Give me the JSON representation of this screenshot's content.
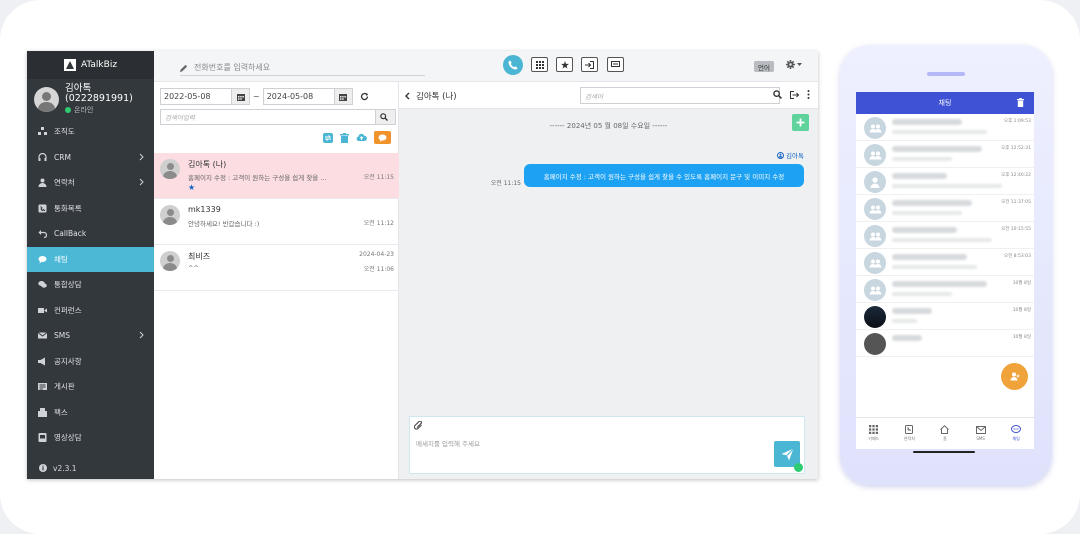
{
  "app": {
    "name": "ATalkBiz",
    "version": "v2.3.1"
  },
  "profile": {
    "name": "김아톡\n(0222891991)",
    "status": "온라인"
  },
  "sidebar": {
    "items": [
      {
        "label": "조직도",
        "icon": "org-icon"
      },
      {
        "label": "CRM",
        "icon": "headset-icon",
        "has_submenu": true
      },
      {
        "label": "연락처",
        "icon": "contact-icon",
        "has_submenu": true
      },
      {
        "label": "통화목록",
        "icon": "call-log-icon"
      },
      {
        "label": "CallBack",
        "icon": "callback-icon"
      },
      {
        "label": "채팅",
        "icon": "chat-icon",
        "active": true
      },
      {
        "label": "통합상담",
        "icon": "consult-icon"
      },
      {
        "label": "컨퍼런스",
        "icon": "video-icon"
      },
      {
        "label": "SMS",
        "icon": "sms-icon",
        "has_submenu": true
      },
      {
        "label": "공지사항",
        "icon": "megaphone-icon"
      },
      {
        "label": "게시판",
        "icon": "board-icon"
      },
      {
        "label": "팩스",
        "icon": "fax-icon"
      },
      {
        "label": "영상상담",
        "icon": "video-consult-icon"
      }
    ]
  },
  "topbar": {
    "phone_placeholder": "전화번호를 입력하세요",
    "language_label": "언어"
  },
  "list": {
    "date_from": "2022-05-08",
    "date_to": "2024-05-08",
    "date_sep": "~",
    "search_placeholder": "검색어입력",
    "chats": [
      {
        "name": "김아톡 (나)",
        "preview": "홈페이지 수정 : 고객이 원하는 구성을 쉽게 찾을 ...",
        "time": "오전 11:15",
        "date": "",
        "starred": true,
        "selected": true
      },
      {
        "name": "mk1339",
        "preview": "안녕하세요! 반갑습니다 :)",
        "time": "오전 11:12",
        "date": "",
        "starred": false,
        "selected": false
      },
      {
        "name": "최비즈",
        "preview": "^^",
        "time": "오전 11:06",
        "date": "2024-04-23",
        "starred": false,
        "selected": false
      }
    ]
  },
  "conversation": {
    "title": "김아톡 (나)",
    "search_placeholder": "검색어",
    "date_separator": "------ 2024년 05 월 08일 수요일 ------",
    "messages": [
      {
        "sender": "김아톡",
        "text": "홈페이지 수정 : 고객이 원하는 구성을 쉽게 찾을 수 있도록 홈페이지 문구 및 이미지 수정",
        "time": "오전 11:15"
      }
    ],
    "composer_placeholder": "메세지를 입력해 주세요"
  },
  "mobile": {
    "title": "채팅",
    "rows": [
      {
        "time": "오후 1:09:53",
        "avatar": "group"
      },
      {
        "time": "오후 12:52:31",
        "avatar": "group"
      },
      {
        "time": "오후 12:40:22",
        "avatar": "person"
      },
      {
        "time": "오전 11:37:05",
        "avatar": "group"
      },
      {
        "time": "오전 10:15:55",
        "avatar": "group"
      },
      {
        "time": "오전 8:53:03",
        "avatar": "group"
      },
      {
        "time": "10월 8일",
        "avatar": "group"
      },
      {
        "time": "10월 8일",
        "avatar": "photo-dark"
      },
      {
        "time": "10월 8일",
        "avatar": "photo-person"
      }
    ],
    "nav": [
      {
        "label": "키패드",
        "icon": "keypad-icon"
      },
      {
        "label": "연락처",
        "icon": "phonebook-icon"
      },
      {
        "label": "홈",
        "icon": "home-icon"
      },
      {
        "label": "SMS",
        "icon": "mail-icon"
      },
      {
        "label": "채팅",
        "icon": "chat-bubble-icon",
        "active": true
      }
    ]
  },
  "colors": {
    "sidebar_bg": "#33383d",
    "accent": "#4bb6d3",
    "bubble": "#1da1f2",
    "mobile_header": "#3f51d4",
    "selected_row": "#fbdde2"
  }
}
